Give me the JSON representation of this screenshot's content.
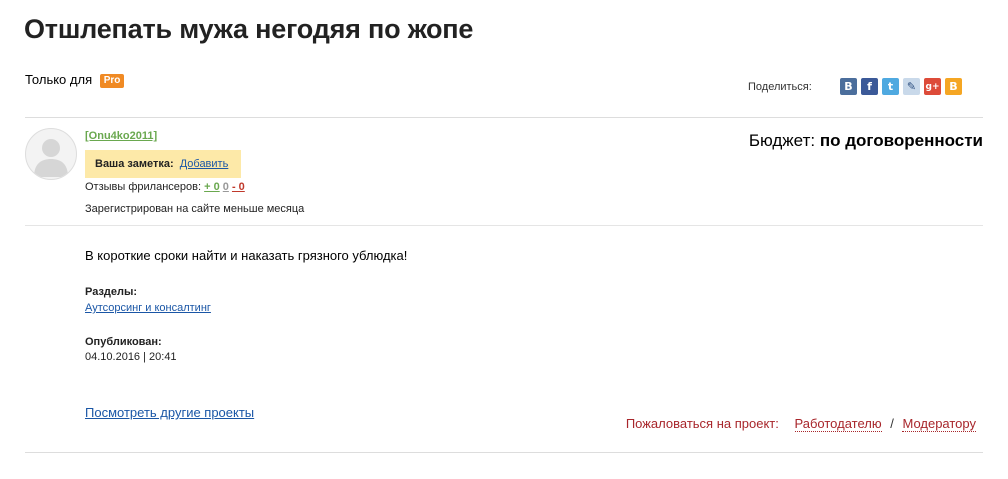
{
  "page": {
    "title": "Отшлепать мужа негодяя по жопе",
    "only_for": "Только для",
    "pro_badge": "Pro"
  },
  "share": {
    "label": "Поделиться:",
    "icons": [
      "vk-icon",
      "facebook-icon",
      "twitter-icon",
      "livejournal-icon",
      "google-plus-icon",
      "blogger-icon"
    ]
  },
  "client": {
    "username": "[Onu4ko2011]",
    "note_label": "Ваша заметка:",
    "note_action": "Добавить",
    "reviews_label": "Отзывы фрилансеров:",
    "reviews_positive": "+ 0",
    "reviews_neutral": "0",
    "reviews_negative": "- 0",
    "registered": "Зарегистрирован на сайте меньше месяца"
  },
  "budget": {
    "label": "Бюджет:",
    "value": "по договоренности"
  },
  "project": {
    "description": "В короткие сроки найти и наказать грязного ублюдка!",
    "sections_label": "Разделы:",
    "section_link": "Аутсорсинг и консалтинг",
    "published_label": "Опубликован:",
    "published_date": "04.10.2016 | 20:41"
  },
  "footer": {
    "other_projects": "Посмотреть другие проекты",
    "complain_label": "Пожаловаться на проект:",
    "complain_employer": "Работодателю",
    "separator": "/",
    "complain_moderator": "Модератору"
  },
  "colors": {
    "accent_link": "#1a56a6",
    "pro_badge": "#f08a24",
    "note_bg": "#fde9a8",
    "positive": "#6aa84f",
    "negative": "#c0392b",
    "complain": "#a8262b"
  }
}
